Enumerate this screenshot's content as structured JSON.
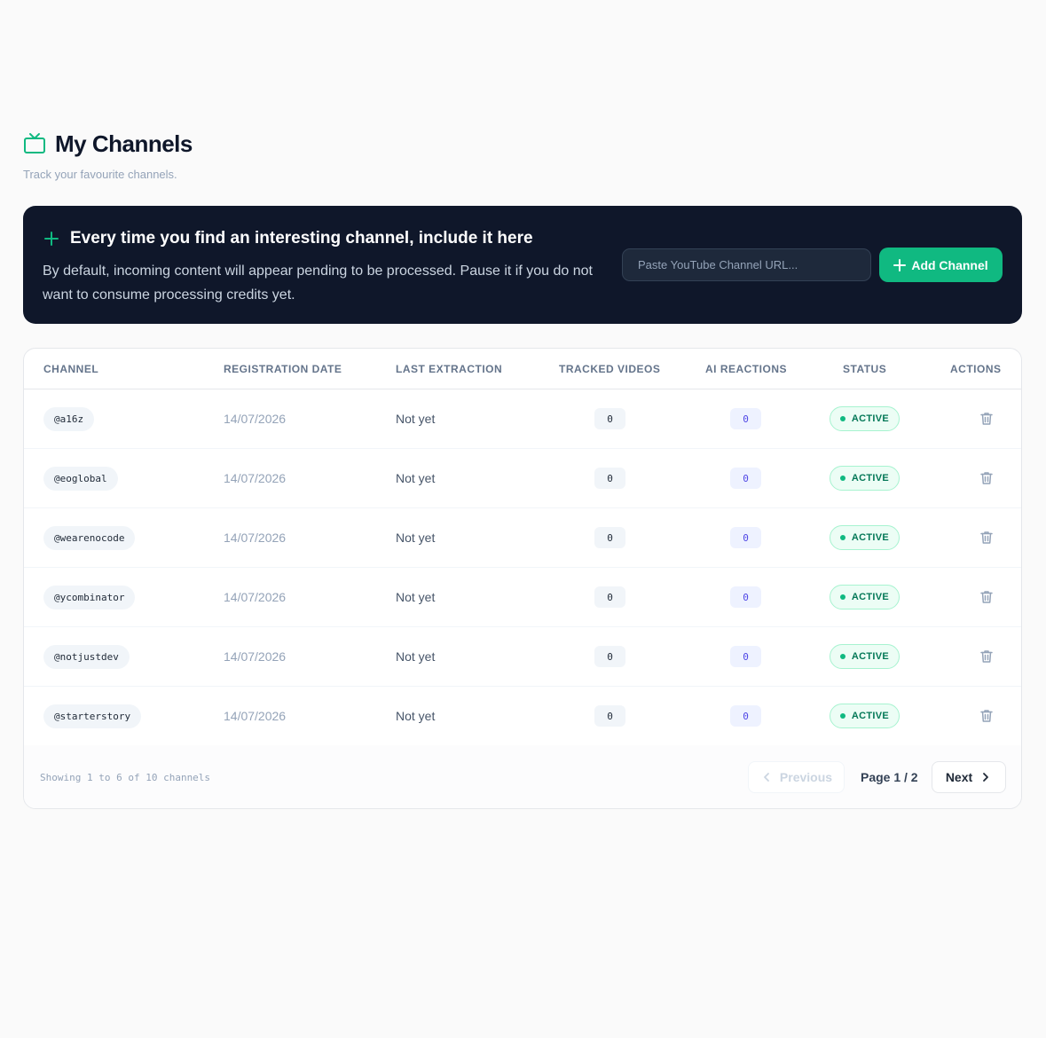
{
  "header": {
    "title": "My Channels",
    "subtitle": "Track your favourite channels."
  },
  "banner": {
    "title": "Every time you find an interesting channel, include it here",
    "text": "By default, incoming content will appear pending to be processed. Pause it if you do not want to consume processing credits yet.",
    "input_placeholder": "Paste YouTube Channel URL...",
    "add_label": "Add Channel"
  },
  "table": {
    "columns": [
      "CHANNEL",
      "REGISTRATION DATE",
      "LAST EXTRACTION",
      "TRACKED VIDEOS",
      "AI REACTIONS",
      "STATUS",
      "ACTIONS"
    ],
    "rows": [
      {
        "channel": "@a16z",
        "date": "14/07/2026",
        "last": "Not yet",
        "videos": "0",
        "reactions": "0",
        "status": "ACTIVE"
      },
      {
        "channel": "@eoglobal",
        "date": "14/07/2026",
        "last": "Not yet",
        "videos": "0",
        "reactions": "0",
        "status": "ACTIVE"
      },
      {
        "channel": "@wearenocode",
        "date": "14/07/2026",
        "last": "Not yet",
        "videos": "0",
        "reactions": "0",
        "status": "ACTIVE"
      },
      {
        "channel": "@ycombinator",
        "date": "14/07/2026",
        "last": "Not yet",
        "videos": "0",
        "reactions": "0",
        "status": "ACTIVE"
      },
      {
        "channel": "@notjustdev",
        "date": "14/07/2026",
        "last": "Not yet",
        "videos": "0",
        "reactions": "0",
        "status": "ACTIVE"
      },
      {
        "channel": "@starterstory",
        "date": "14/07/2026",
        "last": "Not yet",
        "videos": "0",
        "reactions": "0",
        "status": "ACTIVE"
      }
    ]
  },
  "footer": {
    "showing": "Showing 1 to 6 of 10 channels",
    "previous_label": "Previous",
    "page_label": "Page 1 / 2",
    "next_label": "Next"
  },
  "colors": {
    "accent": "#10b981",
    "banner_bg": "#0f172a",
    "status_active": "#047857",
    "reaction_chip": "#4f46e5"
  },
  "icons": {
    "header": "tv-icon",
    "banner": "plus-icon",
    "row_action": "trash-icon",
    "prev": "chevron-left-icon",
    "next": "chevron-right-icon"
  }
}
